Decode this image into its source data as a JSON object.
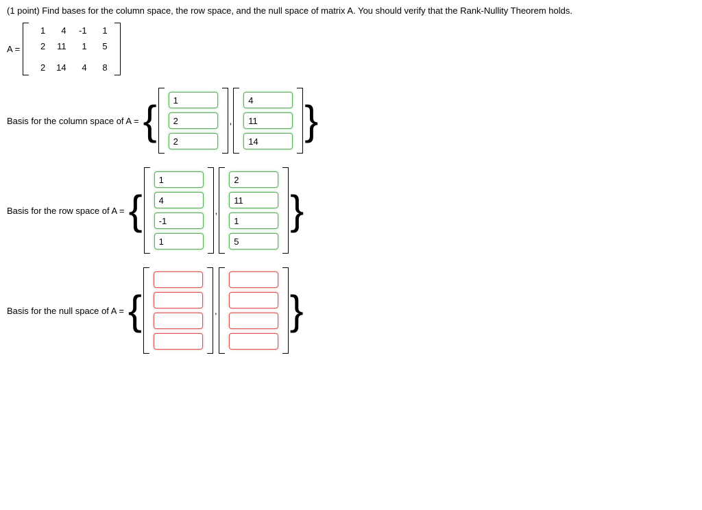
{
  "question": "(1 point) Find bases for the column space, the row space, and the null space of matrix A. You should verify that the Rank-Nullity Theorem holds.",
  "matrixA_label": "A =",
  "matrixA": [
    [
      "1",
      "4",
      "-1",
      "1"
    ],
    [
      "2",
      "11",
      "1",
      "5"
    ],
    [
      "",
      "",
      "",
      ""
    ],
    [
      "2",
      "14",
      "4",
      "8"
    ]
  ],
  "colspace_label": "Basis for the column space of A =",
  "rowspace_label": "Basis for the row space of A =",
  "nullspace_label": "Basis for the null space of A =",
  "colspace": {
    "v1": [
      "1",
      "2",
      "2"
    ],
    "v2": [
      "4",
      "11",
      "14"
    ]
  },
  "rowspace": {
    "v1": [
      "1",
      "4",
      "-1",
      "1"
    ],
    "v2": [
      "2",
      "11",
      "1",
      "5"
    ]
  },
  "nullspace": {
    "v1": [
      "",
      "",
      "",
      ""
    ],
    "v2": [
      "",
      "",
      "",
      ""
    ]
  },
  "comma": ","
}
